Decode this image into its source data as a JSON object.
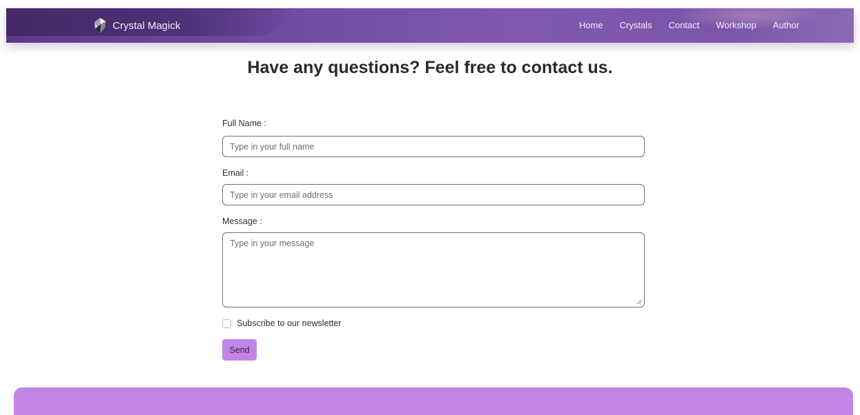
{
  "brand": {
    "name": "Crystal Magick",
    "icon": "crystal-logo-icon"
  },
  "nav": {
    "items": [
      "Home",
      "Crystals",
      "Contact",
      "Workshop",
      "Author"
    ]
  },
  "heading": "Have any questions? Feel free to contact us.",
  "form": {
    "full_name": {
      "label": "Full Name :",
      "placeholder": "Type in your full name",
      "value": ""
    },
    "email": {
      "label": "Email :",
      "placeholder": "Type in your email address",
      "value": ""
    },
    "message": {
      "label": "Message :",
      "placeholder": "Type in your message",
      "value": ""
    },
    "newsletter": {
      "label": "Subscribe to our newsletter",
      "checked": false
    },
    "send_label": "Send"
  },
  "colors": {
    "nav_bg": "#6f4aa0",
    "accent": "#c384e8",
    "text": "#2b2b2b"
  }
}
